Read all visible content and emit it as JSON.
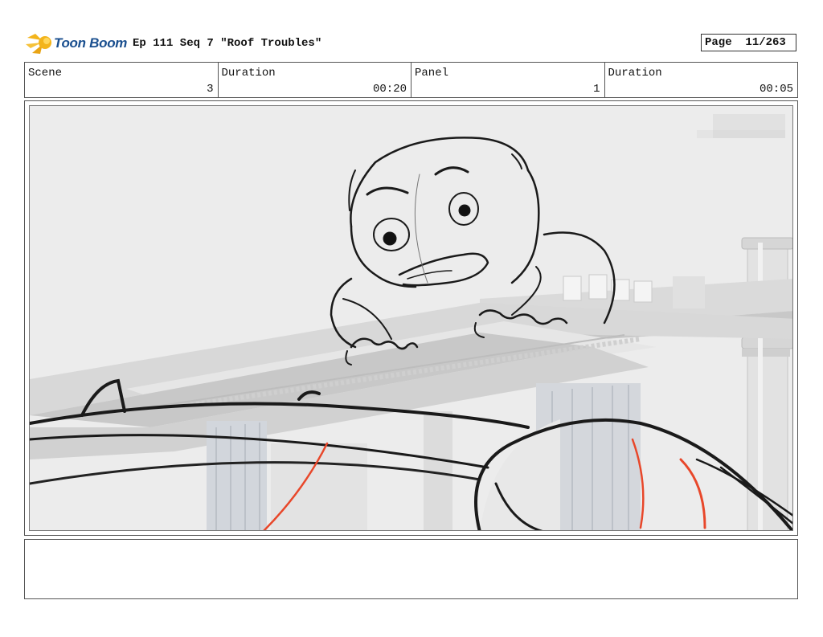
{
  "header": {
    "logo_text": "Toon Boom",
    "episode_title": "Ep 111 Seq 7 \"Roof Troubles\"",
    "page_label": "Page",
    "page_value": "11/263"
  },
  "info": {
    "scene_label": "Scene",
    "scene_value": "3",
    "scene_duration_label": "Duration",
    "scene_duration_value": "00:20",
    "panel_label": "Panel",
    "panel_value": "1",
    "panel_duration_label": "Duration",
    "panel_duration_value": "00:05"
  },
  "colors": {
    "logo_blue": "#1a4f8f",
    "logo_yellow": "#f3b41b",
    "sketch_line": "#1a1a1a",
    "red_line": "#e8472a"
  },
  "icons": {
    "logo": "toon-boom-star-icon"
  }
}
